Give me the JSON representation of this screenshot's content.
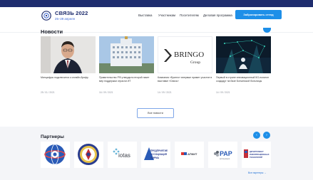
{
  "header": {
    "title": "СВЯЗЬ 2022",
    "dates": "25–29 апреля",
    "nav": [
      "Выставка",
      "Участникам",
      "Посетителям",
      "Деловая программа"
    ],
    "book_button": "Забронировать стенд"
  },
  "news": {
    "title": "Новости",
    "items": [
      {
        "text": "Минцифры подключится к онлайн-брифу",
        "date": "25 / 01 / 2021"
      },
      {
        "text": "Правительство РФ утвердило второй пакет мер поддержки отрасли ИТ",
        "date": "16 / 09 / 2021"
      },
      {
        "text": "Компания «Бринго» впервые примет участие в выставке «Связь»",
        "date": "14 / 09 / 2021"
      },
      {
        "text": "Первый в стране инновационный 5G-полигон создадут на базе Боткинской больницы",
        "date": "14 / 09 / 2021"
      }
    ],
    "all_button": "Все новости"
  },
  "brand_logo": {
    "name": "BRINGO",
    "sub": "Group"
  },
  "partners": {
    "title": "Партнеры",
    "prev": "‹",
    "next": "›",
    "all_link": "Все партнеры →",
    "tile_texts": {
      "iotas": "iotas",
      "assoc_line1": "ПРЕДПРИЯТИЕ",
      "assoc_line2": "АССОЦИАЦИЯ",
      "assoc_line3": "ФИРМА",
      "apkit": "АПКИТ",
      "rap": "РАР",
      "rap_sub": "ассоциация",
      "last_line1": "ДЕПАРТАМЕНТ",
      "last_line2": "ИНФОРМАЦИОННЫХ",
      "last_line3": "ТЕХНОЛОГИЙ"
    }
  },
  "colors": {
    "accent": "#1e8fe8",
    "navy": "#1f2d6e"
  }
}
